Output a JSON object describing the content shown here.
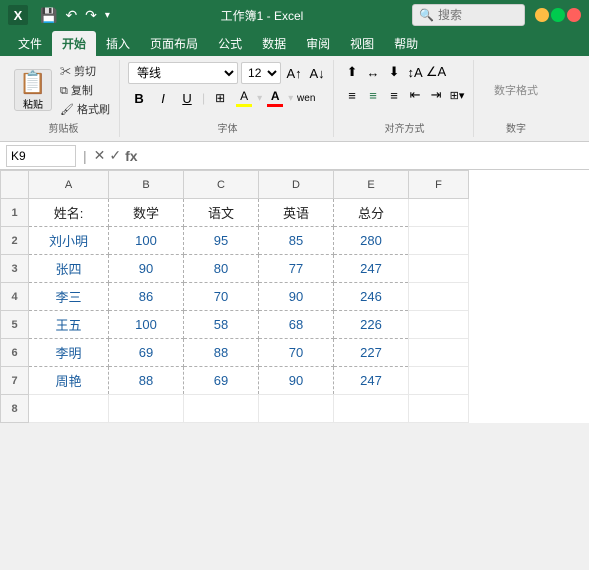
{
  "titleBar": {
    "appName": "Excel",
    "title": "工作簿1 - Excel",
    "searchPlaceholder": "搜索"
  },
  "ribbonTabs": {
    "tabs": [
      "文件",
      "开始",
      "插入",
      "页面布局",
      "公式",
      "数据",
      "审阅",
      "视图",
      "帮助"
    ],
    "activeTab": "开始"
  },
  "ribbonGroups": {
    "clipboard": {
      "label": "剪贴板",
      "pasteLabel": "粘贴",
      "cutLabel": "✂",
      "copyLabel": "复制"
    },
    "font": {
      "label": "字体",
      "fontName": "等线",
      "fontSize": "12"
    },
    "alignment": {
      "label": "对齐方式"
    },
    "number": {
      "label": "数字"
    }
  },
  "formulaBar": {
    "cellRef": "K9",
    "formula": ""
  },
  "columns": {
    "headers": [
      "A",
      "B",
      "C",
      "D",
      "E",
      "F"
    ]
  },
  "rows": [
    {
      "rowNum": "1",
      "cells": [
        "姓名:",
        "数学",
        "语文",
        "英语",
        "总分",
        ""
      ]
    },
    {
      "rowNum": "2",
      "cells": [
        "刘小明",
        "100",
        "95",
        "85",
        "280",
        ""
      ]
    },
    {
      "rowNum": "3",
      "cells": [
        "张四",
        "90",
        "80",
        "77",
        "247",
        ""
      ]
    },
    {
      "rowNum": "4",
      "cells": [
        "李三",
        "86",
        "70",
        "90",
        "246",
        ""
      ]
    },
    {
      "rowNum": "5",
      "cells": [
        "王五",
        "100",
        "58",
        "68",
        "226",
        ""
      ]
    },
    {
      "rowNum": "6",
      "cells": [
        "李明",
        "69",
        "88",
        "70",
        "227",
        ""
      ]
    },
    {
      "rowNum": "7",
      "cells": [
        "周艳",
        "88",
        "69",
        "90",
        "247",
        ""
      ]
    },
    {
      "rowNum": "8",
      "cells": [
        "",
        "",
        "",
        "",
        "",
        ""
      ]
    }
  ]
}
